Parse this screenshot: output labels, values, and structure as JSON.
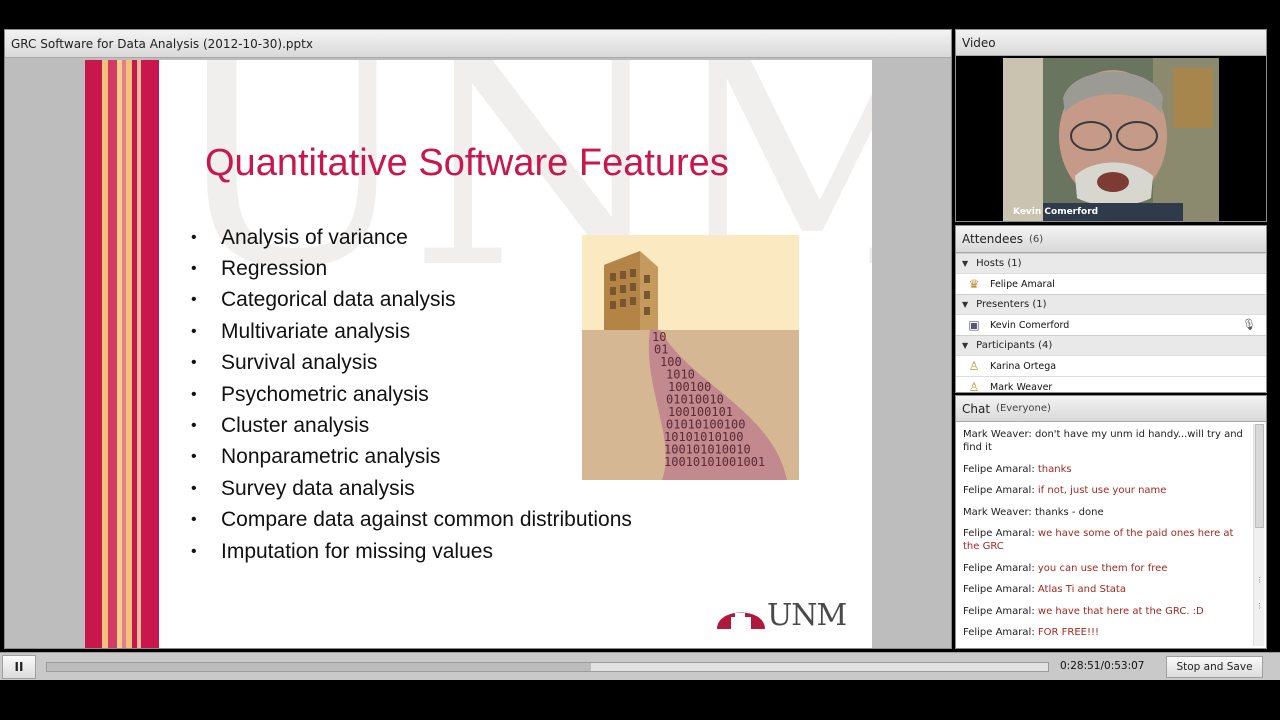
{
  "share": {
    "title": "GRC Software for Data Analysis (2012-10-30).pptx",
    "slide": {
      "watermark": "UNM",
      "title": "Quantitative Software Features",
      "bullets": [
        "Analysis of variance",
        "Regression",
        "Categorical data analysis",
        "Multivariate analysis",
        "Survival analysis",
        "Psychometric analysis",
        "Cluster analysis",
        "Nonparametric analysis",
        "Survey data analysis",
        "Compare data against common distributions",
        "Imputation for missing values"
      ],
      "binary_lines": [
        "10",
        "01",
        "100",
        "1010",
        "100100",
        "01010010",
        "100100101",
        "01010100100",
        "10101010100",
        "100101010010",
        "10010101001001"
      ],
      "logo_text": "UNM",
      "accent_color": "#c8174d"
    }
  },
  "video": {
    "title": "Video",
    "presenter_name": "Kevin Comerford"
  },
  "attendees": {
    "title": "Attendees",
    "count": "(6)",
    "groups": [
      {
        "label": "Hosts (1)",
        "members": [
          {
            "name": "Felipe Amaral",
            "icon": "host-icon"
          }
        ]
      },
      {
        "label": "Presenters (1)",
        "members": [
          {
            "name": "Kevin Comerford",
            "icon": "presenter-icon",
            "mic": "microphone-icon"
          }
        ]
      },
      {
        "label": "Participants (4)",
        "members": [
          {
            "name": "Karina Ortega",
            "icon": "participant-icon"
          },
          {
            "name": "Mark Weaver",
            "icon": "participant-icon"
          }
        ]
      }
    ]
  },
  "chat": {
    "title": "Chat",
    "audience": "(Everyone)",
    "messages": [
      {
        "sender": "Mark Weaver:",
        "text": "don't have my unm id handy...will try and find it",
        "host": false
      },
      {
        "sender": "Felipe Amaral:",
        "text": "thanks",
        "host": true
      },
      {
        "sender": "Felipe Amaral:",
        "text": "if not, just use your name",
        "host": true
      },
      {
        "sender": "Mark Weaver:",
        "text": "thanks - done",
        "host": false
      },
      {
        "sender": "Felipe Amaral:",
        "text": "we have some of the paid ones here at the GRC",
        "host": true
      },
      {
        "sender": "Felipe Amaral:",
        "text": "you can use them for free",
        "host": true
      },
      {
        "sender": "Felipe Amaral:",
        "text": "Atlas Ti and Stata",
        "host": true
      },
      {
        "sender": "Felipe Amaral:",
        "text": "we have that here at the GRC. :D",
        "host": true
      },
      {
        "sender": "Felipe Amaral:",
        "text": "FOR FREE!!!",
        "host": true
      }
    ],
    "host_color": "#a3271f"
  },
  "playback": {
    "pause_glyph": "II",
    "time": "0:28:51/0:53:07",
    "progress": 0.543,
    "stop_label": "Stop and Save"
  }
}
